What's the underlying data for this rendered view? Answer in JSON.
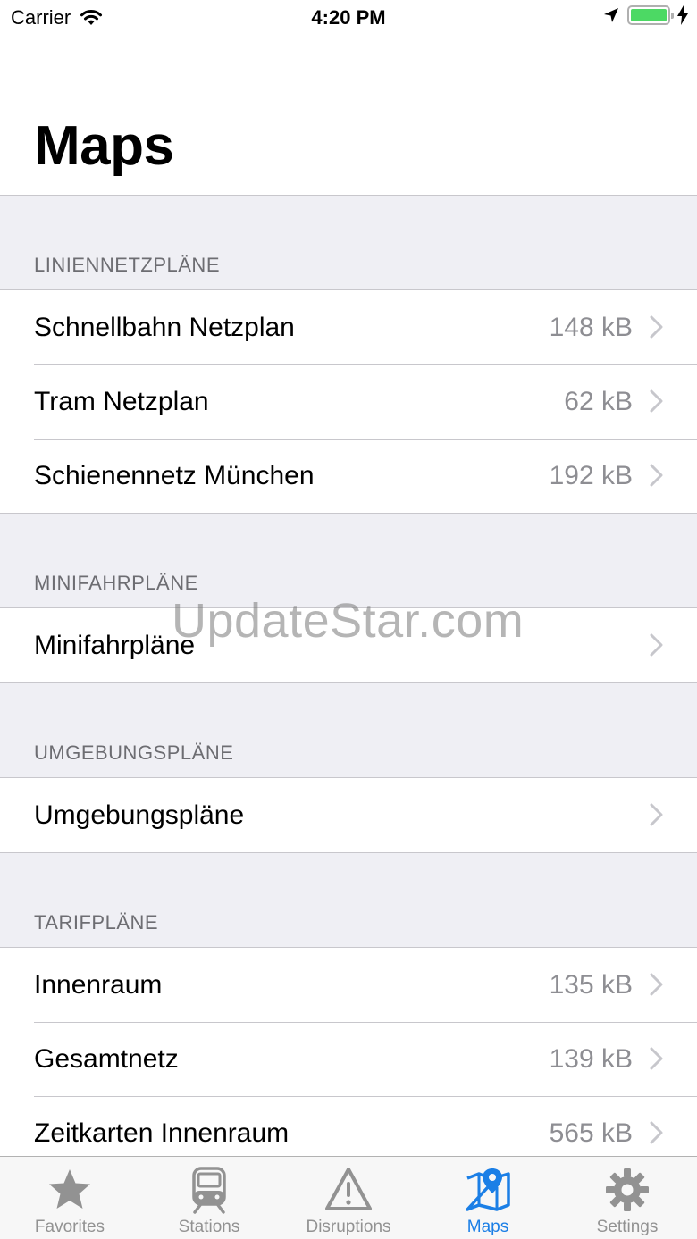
{
  "status_bar": {
    "carrier": "Carrier",
    "time": "4:20 PM",
    "battery_level": 1.0
  },
  "title": "Maps",
  "sections": [
    {
      "header": "LINIENNETZPLÄNE",
      "rows": [
        {
          "title": "Schnellbahn Netzplan",
          "detail": "148 kB"
        },
        {
          "title": "Tram Netzplan",
          "detail": "62 kB"
        },
        {
          "title": "Schienennetz München",
          "detail": "192 kB"
        }
      ]
    },
    {
      "header": "MINIFAHRPLÄNE",
      "rows": [
        {
          "title": "Minifahrpläne",
          "detail": ""
        }
      ]
    },
    {
      "header": "UMGEBUNGSPLÄNE",
      "rows": [
        {
          "title": "Umgebungspläne",
          "detail": ""
        }
      ]
    },
    {
      "header": "TARIFPLÄNE",
      "rows": [
        {
          "title": "Innenraum",
          "detail": "135 kB"
        },
        {
          "title": "Gesamtnetz",
          "detail": "139 kB"
        },
        {
          "title": "Zeitkarten Innenraum",
          "detail": "565 kB"
        }
      ]
    }
  ],
  "watermark": "UpdateStar.com",
  "tab_bar": {
    "tabs": [
      {
        "label": "Favorites",
        "icon": "star-icon",
        "active": false
      },
      {
        "label": "Stations",
        "icon": "train-icon",
        "active": false
      },
      {
        "label": "Disruptions",
        "icon": "warning-icon",
        "active": false
      },
      {
        "label": "Maps",
        "icon": "map-pin-icon",
        "active": true
      },
      {
        "label": "Settings",
        "icon": "gear-icon",
        "active": false
      }
    ],
    "active_color": "#1b7fe6",
    "inactive_color": "#929292"
  }
}
